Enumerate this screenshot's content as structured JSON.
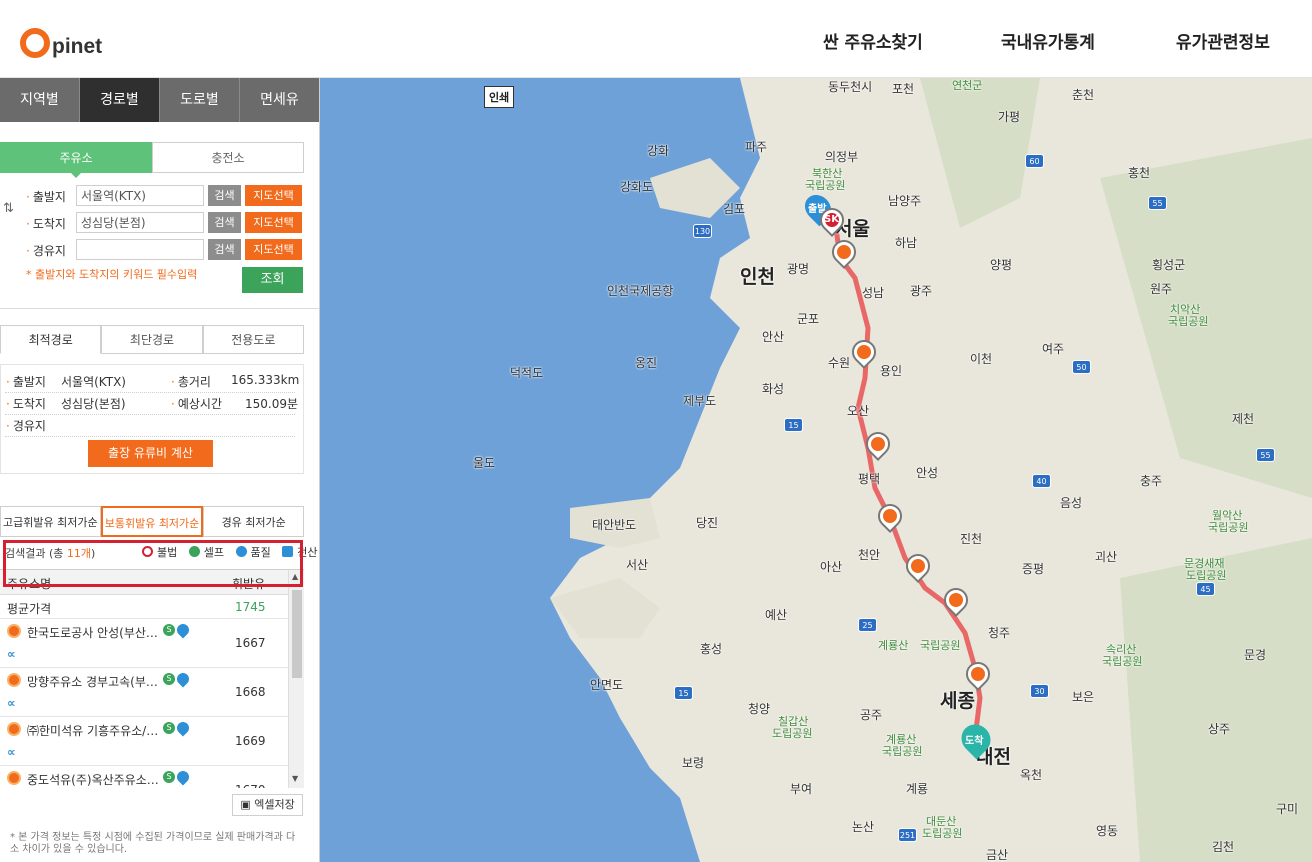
{
  "logo": {
    "text": "pinet"
  },
  "nav": [
    "싼 주유소찾기",
    "국내유가통계",
    "유가관련정보"
  ],
  "main_tabs": [
    "지역별",
    "경로별",
    "도로별",
    "면세유"
  ],
  "sub_tabs": [
    "주유소",
    "충전소"
  ],
  "form": {
    "origin": {
      "label": "출발지",
      "value": "서울역(KTX)"
    },
    "destination": {
      "label": "도착지",
      "value": "성심당(본점)"
    },
    "waypoint": {
      "label": "경유지",
      "value": ""
    },
    "search_label": "검색",
    "map_select_label": "지도선택",
    "required_note": "* 출발지와 도착지의 키워드 필수입력",
    "query_label": "조회"
  },
  "route_tabs": [
    "최적경로",
    "최단경로",
    "전용도로"
  ],
  "route_info": {
    "origin_label": "출발지",
    "origin_value": "서울역(KTX)",
    "distance_label": "총거리",
    "distance_value": "165.333km",
    "dest_label": "도착지",
    "dest_value": "성심당(본점)",
    "time_label": "예상시간",
    "time_value": "150.09분",
    "waypoint_label": "경유지",
    "calc_button": "출장 유류비 계산"
  },
  "fuel_tabs": [
    "고급휘발유 최저가순",
    "보통휘발유 최저가순",
    "경유 최저가순"
  ],
  "results": {
    "prefix": "검색결과 (총 ",
    "count": "11개",
    "suffix": ")",
    "legend": [
      "불법",
      "셀프",
      "품질",
      "전산"
    ]
  },
  "table": {
    "col_name": "주유소명",
    "col_price": "휘발유",
    "avg_label": "평균가격",
    "avg_value": "1745",
    "rows": [
      {
        "name": "한국도로공사 안성(부산…",
        "price": "1667"
      },
      {
        "name": "망향주유소 경부고속(부…",
        "price": "1668"
      },
      {
        "name": "㈜한미석유 기흥주유소/…",
        "price": "1669"
      },
      {
        "name": "중도석유(주)옥산주유소…",
        "price": "1670"
      }
    ]
  },
  "excel_label": "엑셀저장",
  "footnote": "* 본 가격 정보는 특정 시점에 수집된 가격이므로 실제 판매가격과 다소 차이가 있을 수 있습니다.",
  "map": {
    "box_label": "인쇄",
    "start_pin": "출발",
    "end_pin": "도착",
    "sk_label": "SK",
    "labels": [
      "동두천시",
      "포천",
      "춘천",
      "연천군",
      "파주",
      "의정부",
      "강화",
      "가평",
      "강화도",
      "북한산",
      "국립공원",
      "남양주",
      "김포",
      "서울",
      "하남",
      "홍천",
      "인천",
      "광명",
      "양평",
      "횡성군",
      "인천국제공항",
      "성남",
      "광주",
      "원주",
      "군포",
      "안산",
      "옹진",
      "덕적도",
      "수원",
      "용인",
      "이천",
      "여주",
      "화성",
      "제부도",
      "오산",
      "치악산",
      "국립공원",
      "제천",
      "울도",
      "평택",
      "안성",
      "충주",
      "태안반도",
      "당진",
      "음성",
      "월악산",
      "국립공원",
      "서산",
      "아산",
      "천안",
      "진천",
      "괴산",
      "증평",
      "문경새재",
      "도립공원",
      "예산",
      "청주",
      "속리산",
      "국립공원",
      "홍성",
      "계룡산",
      "국립공원",
      "안면도",
      "세종",
      "보은",
      "문경",
      "청양",
      "칠갑산",
      "도립공원",
      "공주",
      "상주",
      "계룡산",
      "국립공원",
      "보령",
      "대전",
      "옥천",
      "부여",
      "계룡",
      "구미",
      "논산",
      "대둔산",
      "도립공원",
      "영동",
      "김천",
      "금산"
    ]
  }
}
